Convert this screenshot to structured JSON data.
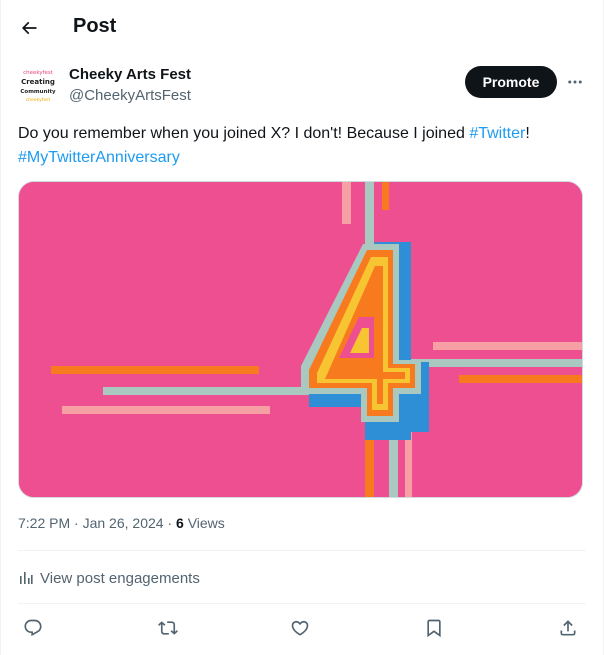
{
  "header": {
    "title": "Post",
    "back_icon": "arrow-left-icon"
  },
  "author": {
    "name": "Cheeky Arts Fest",
    "handle": "@CheekyArtsFest",
    "avatar_text": [
      "cheekyfest",
      "Creating",
      "Community",
      "cheekyfest"
    ]
  },
  "promote_label": "Promote",
  "more_icon": "more-horizontal-icon",
  "post": {
    "text_part1": "Do you remember when you joined X? I don't!  Because I joined ",
    "hashtag1": "#Twitter",
    "text_part2": "!",
    "hashtag2": "#MyTwitterAnniversary"
  },
  "media": {
    "description_icon": "image-number-4-artwork",
    "colors": {
      "background": "#ee4f90",
      "yellow": "#f7c531",
      "orange": "#f77a1f",
      "blue": "#2f8fd6",
      "sage": "#a8c8c0",
      "pink": "#f6a0a6"
    }
  },
  "meta": {
    "time": "7:22 PM",
    "separator": " · ",
    "date": "Jan 26, 2024",
    "separator2": " · ",
    "views_count": "6",
    "views_label": " Views"
  },
  "engagements_label": "View post engagements",
  "actions": [
    "reply-icon",
    "repost-icon",
    "like-icon",
    "bookmark-icon",
    "share-icon"
  ],
  "colors": {
    "text": "#0f1419",
    "secondary": "#536471",
    "link": "#1d9bf0",
    "border": "#eff3f4"
  }
}
